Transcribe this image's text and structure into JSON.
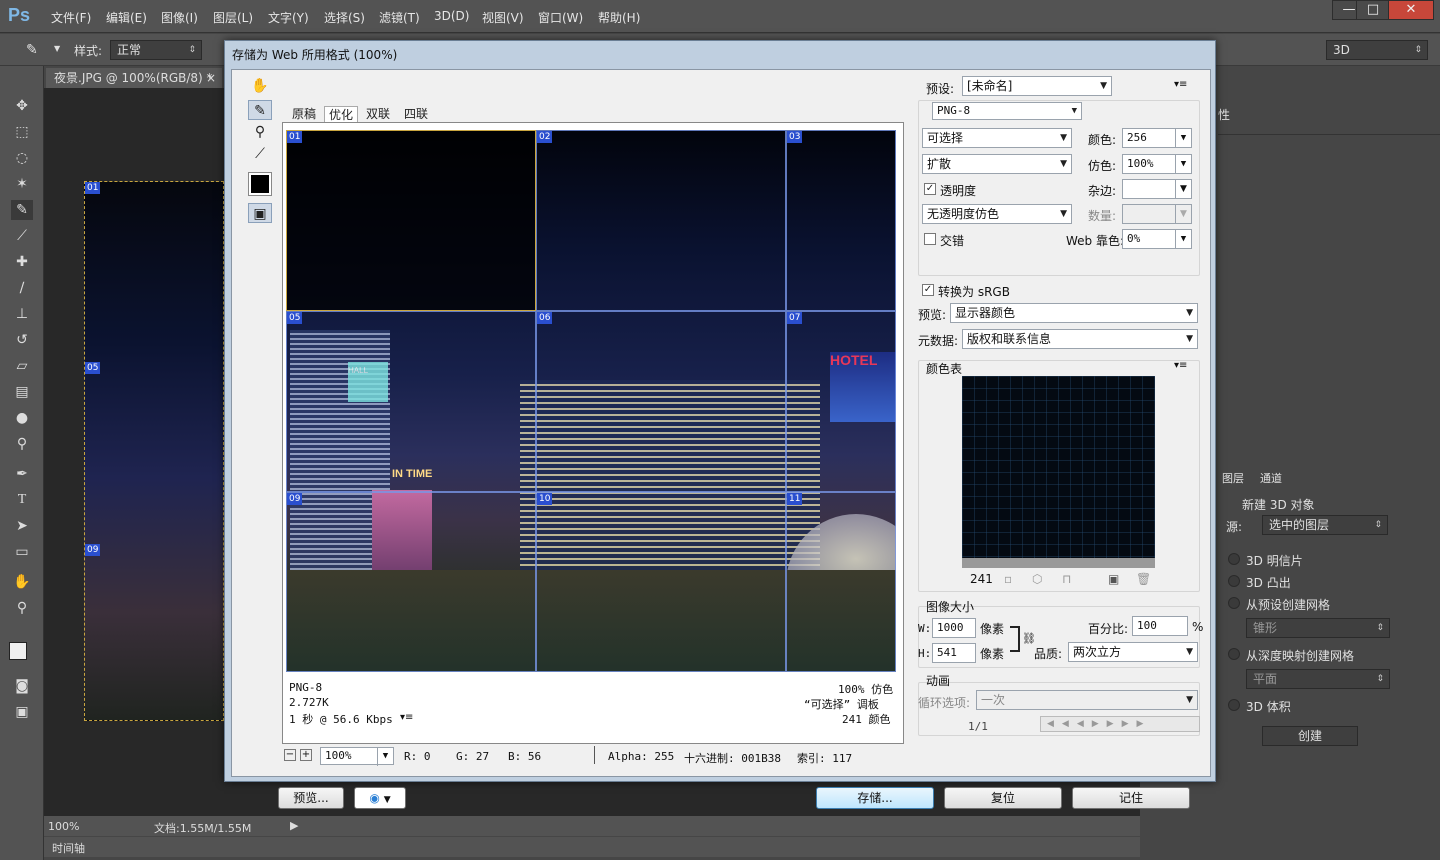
{
  "app": {
    "logo": "Ps",
    "menus": [
      "文件(F)",
      "编辑(E)",
      "图像(I)",
      "图层(L)",
      "文字(Y)",
      "选择(S)",
      "滤镜(T)",
      "3D(D)",
      "视图(V)",
      "窗口(W)",
      "帮助(H)"
    ],
    "window_controls": [
      "—",
      "□",
      "✕"
    ]
  },
  "options_bar": {
    "style_label": "样式:",
    "style_value": "正常",
    "workspace": "3D"
  },
  "document": {
    "tab_label": "夜景.JPG @ 100%(RGB/8) *",
    "tab_close": "×",
    "slice_labels": [
      "01",
      "05",
      "09"
    ]
  },
  "status_bar": {
    "zoom": "100%",
    "doc_info": "文档:1.55M/1.55M",
    "timeline_label": "时间轴"
  },
  "right_panel": {
    "properties_tab": "性",
    "tabs": [
      "图层",
      "通道"
    ],
    "new_3d_object": "新建 3D 对象",
    "source_label": "源:",
    "source_value": "选中的图层",
    "options": [
      "3D 明信片",
      "3D 凸出",
      "从预设创建网格",
      "从深度映射创建网格",
      "3D 体积"
    ],
    "preset_mesh": "锥形",
    "depth_mesh": "平面",
    "create_button": "创建"
  },
  "dialog": {
    "title": "存储为 Web 所用格式 (100%)",
    "view_tabs": [
      "原稿",
      "优化",
      "双联",
      "四联"
    ],
    "preset_label": "预设:",
    "preset_value": "[未命名]",
    "format_value": "PNG-8",
    "reduction_value": "可选择",
    "dither_algo": "扩散",
    "transparency_label": "透明度",
    "transparency_dither": "无透明度仿色",
    "interlace_label": "交错",
    "colors_label": "颜色:",
    "colors_value": "256",
    "dither_label": "仿色:",
    "dither_value": "100%",
    "matte_label": "杂边:",
    "amount_label": "数量:",
    "web_snap_label": "Web 靠色:",
    "web_snap_value": "0%",
    "convert_srgb_label": "转换为 sRGB",
    "preview_label": "预览:",
    "preview_value": "显示器颜色",
    "metadata_label": "元数据:",
    "metadata_value": "版权和联系信息",
    "color_table_label": "颜色表",
    "color_count": "241",
    "image_size_label": "图像大小",
    "w_label": "W:",
    "w_value": "1000",
    "h_label": "H:",
    "h_value": "541",
    "unit_px": "像素",
    "percent_label": "百分比:",
    "percent_value": "100",
    "percent_sign": "%",
    "quality_label": "品质:",
    "quality_value": "两次立方",
    "animation_label": "动画",
    "loop_label": "循环选项:",
    "loop_value": "一次",
    "frame_counter": "1/1",
    "preview_info": {
      "format": "PNG-8",
      "size": "2.727K",
      "time": "1 秒 @ 56.6 Kbps",
      "dither": "100% 仿色",
      "palette": "“可选择” 调板",
      "colors": "241 颜色"
    },
    "slice_labels": [
      "01",
      "02",
      "03",
      "05",
      "06",
      "07",
      "09",
      "10",
      "11"
    ],
    "zoom_value": "100%",
    "readout": {
      "r": "R: 0",
      "g": "G: 27",
      "b": "B: 56",
      "alpha": "Alpha: 255",
      "hex": "十六进制: 001B38",
      "index": "索引: 117"
    },
    "buttons": {
      "preview": "预览...",
      "save": "存储...",
      "reset": "复位",
      "remember": "记住"
    },
    "photo_signs": {
      "hotel": "HOTEL",
      "hall": "HALL",
      "intime": "IN TIME"
    }
  }
}
